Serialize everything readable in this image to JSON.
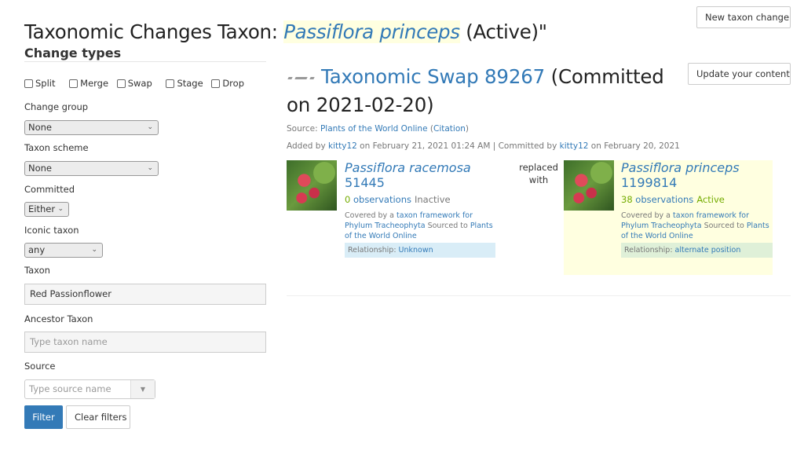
{
  "header": {
    "title_prefix": "Taxonomic Changes Taxon: ",
    "title_taxon": "Passiflora princeps",
    "title_suffix": " (Active)\"",
    "new_change_button": "New taxon change"
  },
  "sidebar": {
    "section_title": "Change types",
    "change_types": [
      {
        "label": "Split",
        "checked": false
      },
      {
        "label": "Merge",
        "checked": false
      },
      {
        "label": "Swap",
        "checked": false
      },
      {
        "label": "Stage",
        "checked": false
      },
      {
        "label": "Drop",
        "checked": false
      }
    ],
    "change_group": {
      "label": "Change group",
      "value": "None"
    },
    "taxon_scheme": {
      "label": "Taxon scheme",
      "value": "None"
    },
    "committed": {
      "label": "Committed",
      "value": "Either"
    },
    "iconic_taxon": {
      "label": "Iconic taxon",
      "value": "any"
    },
    "taxon": {
      "label": "Taxon",
      "value": "Red Passionflower"
    },
    "ancestor_taxon": {
      "label": "Ancestor Taxon",
      "placeholder": "Type taxon name"
    },
    "source": {
      "label": "Source",
      "placeholder": "Type source name"
    },
    "filter_button": "Filter",
    "clear_button": "Clear filters"
  },
  "change": {
    "icon": "swap-icon",
    "title_link": "Taxonomic Swap 89267",
    "title_rest": " (Committed on 2021-02-20)",
    "update_button": "Update your content",
    "source_label": "Source: ",
    "source_link": "Plants of the World Online",
    "citation_open": " (",
    "citation_link": "Citation",
    "citation_close": ")",
    "added_by_prefix": "Added by ",
    "added_by_user": "kitty12",
    "added_on": " on February 21, 2021 01:24 AM | Committed by ",
    "committed_by_user": "kitty12",
    "committed_on": " on February 20, 2021",
    "replaced_with": "replaced with",
    "input_taxon": {
      "name": "Passiflora racemosa",
      "id": "51445",
      "obs_count": "0",
      "obs_label": "observations",
      "status": "Inactive",
      "covered_prefix": "Covered by a ",
      "framework_link": "taxon framework for Phylum Tracheophyta",
      "sourced_to": " Sourced to ",
      "source_link": "Plants of the World Online",
      "relationship_label": "Relationship: ",
      "relationship_value": "Unknown"
    },
    "output_taxon": {
      "name": "Passiflora princeps",
      "id": "1199814",
      "obs_count": "38",
      "obs_label": "observations",
      "status": "Active",
      "covered_prefix": "Covered by a ",
      "framework_link": "taxon framework for Phylum Tracheophyta",
      "sourced_to": " Sourced to ",
      "source_link": "Plants of the World Online",
      "relationship_label": "Relationship: ",
      "relationship_value": "alternate position"
    }
  },
  "colors": {
    "link": "#337ab7",
    "primary_button": "#337ab7",
    "active_green": "#74ac00",
    "highlight_yellow": "#ffffe0",
    "relationship_unknown_bg": "#d9edf7",
    "relationship_alt_bg": "#dff0d8"
  }
}
